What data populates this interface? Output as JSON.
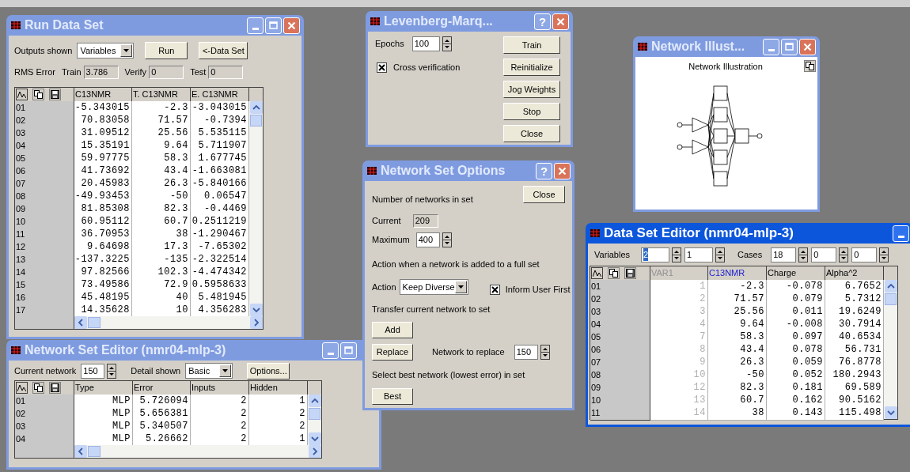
{
  "run_data_set": {
    "title": "Run Data Set",
    "active": false,
    "title_buttons": [
      {
        "kind": "minimize"
      },
      {
        "kind": "maximize"
      },
      {
        "kind": "close"
      }
    ],
    "outputs": {
      "label": "Outputs shown",
      "value": "Variables"
    },
    "buttons": [
      "Run",
      "<-Data Set"
    ],
    "rms": {
      "label": "RMS Error",
      "fields": [
        {
          "label": "Train",
          "value": "3.786"
        },
        {
          "label": "Verify",
          "value": "0"
        },
        {
          "label": "Test",
          "value": "0"
        }
      ]
    },
    "grid": {
      "columns": [
        {
          "label": "C13NMR"
        },
        {
          "label": "T. C13NMR"
        },
        {
          "label": "E. C13NMR"
        }
      ],
      "rows": [
        {
          "label": "01",
          "cells": [
            "-5.343015",
            "-2.3",
            "-3.043015"
          ]
        },
        {
          "label": "02",
          "cells": [
            "70.83058",
            "71.57",
            "-0.7394"
          ]
        },
        {
          "label": "03",
          "cells": [
            "31.09512",
            "25.56",
            "5.535115"
          ]
        },
        {
          "label": "04",
          "cells": [
            "15.35191",
            "9.64",
            "5.711907"
          ]
        },
        {
          "label": "05",
          "cells": [
            "59.97775",
            "58.3",
            "1.677745"
          ]
        },
        {
          "label": "06",
          "cells": [
            "41.73692",
            "43.4",
            "-1.663081"
          ]
        },
        {
          "label": "07",
          "cells": [
            "20.45983",
            "26.3",
            "-5.840166"
          ]
        },
        {
          "label": "08",
          "cells": [
            "-49.93453",
            "-50",
            "0.06547"
          ]
        },
        {
          "label": "09",
          "cells": [
            "81.85308",
            "82.3",
            "-0.4469"
          ]
        },
        {
          "label": "10",
          "cells": [
            "60.95112",
            "60.7",
            "0.2511219"
          ]
        },
        {
          "label": "11",
          "cells": [
            "36.70953",
            "38",
            "-1.290467"
          ]
        },
        {
          "label": "12",
          "cells": [
            "9.64698",
            "17.3",
            "-7.65302"
          ]
        },
        {
          "label": "13",
          "cells": [
            "-137.3225",
            "-135",
            "-2.322514"
          ]
        },
        {
          "label": "14",
          "cells": [
            "97.82566",
            "102.3",
            "-4.474342"
          ]
        },
        {
          "label": "15",
          "cells": [
            "73.49586",
            "72.9",
            "0.5958633"
          ]
        },
        {
          "label": "16",
          "cells": [
            "45.48195",
            "40",
            "5.481945"
          ]
        },
        {
          "label": "17",
          "cells": [
            "14.35628",
            "10",
            "4.356283"
          ]
        }
      ]
    }
  },
  "network_set_editor": {
    "title": "Network Set Editor (nmr04-mlp-3)",
    "active": false,
    "title_buttons": [
      {
        "kind": "minimize"
      },
      {
        "kind": "maximize"
      }
    ],
    "current": {
      "label": "Current network",
      "value": "150"
    },
    "detail": {
      "label": "Detail shown",
      "value": "Basic"
    },
    "options_button": "Options...",
    "grid": {
      "columns": [
        {
          "label": "Type"
        },
        {
          "label": "Error"
        },
        {
          "label": "Inputs"
        },
        {
          "label": "Hidden"
        }
      ],
      "rows": [
        {
          "label": "01",
          "cells": [
            "MLP",
            "5.726094",
            "2",
            "1"
          ]
        },
        {
          "label": "02",
          "cells": [
            "MLP",
            "5.656381",
            "2",
            "2"
          ]
        },
        {
          "label": "03",
          "cells": [
            "MLP",
            "5.340507",
            "2",
            "2"
          ]
        },
        {
          "label": "04",
          "cells": [
            "MLP",
            "5.26662",
            "2",
            "1"
          ]
        }
      ]
    }
  },
  "levenberg_marquardt": {
    "title": "Levenberg-Marq...",
    "active": false,
    "title_buttons": [
      {
        "kind": "help",
        "glyph": "?"
      },
      {
        "kind": "close"
      }
    ],
    "epochs": {
      "label": "Epochs",
      "value": "100"
    },
    "cross_verification": {
      "label": "Cross verification",
      "checked": true
    },
    "buttons": [
      "Train",
      "Reinitialize",
      "Jog Weights",
      "Stop",
      "Close"
    ]
  },
  "network_set_options": {
    "title": "Network Set Options",
    "active": false,
    "title_buttons": [
      {
        "kind": "help",
        "glyph": "?"
      },
      {
        "kind": "close"
      }
    ],
    "count_heading": "Number of networks in set",
    "close_button": "Close",
    "current": {
      "label": "Current",
      "value": "209"
    },
    "maximum": {
      "label": "Maximum",
      "value": "400"
    },
    "action_heading": "Action when a network is added to a full set",
    "action": {
      "label": "Action",
      "value": "Keep Diverse"
    },
    "inform_user": {
      "label": "Inform User First",
      "checked": true
    },
    "transfer_heading": "Transfer current network to set",
    "add_button": "Add",
    "replace_button": "Replace",
    "replace": {
      "label": "Network to replace",
      "value": "150"
    },
    "best_heading": "Select best network (lowest error) in set",
    "best_button": "Best"
  },
  "network_illustration": {
    "title": "Network Illust...",
    "active": false,
    "title_buttons": [
      {
        "kind": "minimize"
      },
      {
        "kind": "maximize"
      },
      {
        "kind": "close"
      }
    ],
    "heading": "Network Illustration"
  },
  "data_set_editor": {
    "title": "Data Set Editor (nmr04-mlp-3)",
    "active": true,
    "title_buttons": [
      {
        "kind": "minimize"
      }
    ],
    "variables": {
      "label": "Variables",
      "fields": [
        {
          "value": "2",
          "selected": true
        },
        {
          "value": "1",
          "selected": false
        }
      ]
    },
    "cases": {
      "label": "Cases",
      "fields": [
        {
          "value": "18",
          "selected": false
        },
        {
          "value": "0",
          "selected": false
        },
        {
          "value": "0",
          "selected": false
        }
      ]
    },
    "grid": {
      "columns": [
        {
          "label": "VAR1",
          "selected": false,
          "disabled": true
        },
        {
          "label": "C13NMR",
          "selected": true,
          "disabled": false
        },
        {
          "label": "Charge",
          "selected": false,
          "disabled": false
        },
        {
          "label": "Alpha^2",
          "selected": false,
          "disabled": false
        }
      ],
      "rows": [
        {
          "label": "01",
          "cells": [
            "1",
            "-2.3",
            "-0.078",
            "6.7652"
          ]
        },
        {
          "label": "02",
          "cells": [
            "2",
            "71.57",
            "0.079",
            "5.7312"
          ]
        },
        {
          "label": "03",
          "cells": [
            "3",
            "25.56",
            "0.011",
            "19.6249"
          ]
        },
        {
          "label": "04",
          "cells": [
            "4",
            "9.64",
            "-0.008",
            "30.7914"
          ]
        },
        {
          "label": "05",
          "cells": [
            "7",
            "58.3",
            "0.097",
            "40.6534"
          ]
        },
        {
          "label": "06",
          "cells": [
            "8",
            "43.4",
            "0.078",
            "56.731"
          ]
        },
        {
          "label": "07",
          "cells": [
            "9",
            "26.3",
            "0.059",
            "76.8778"
          ]
        },
        {
          "label": "08",
          "cells": [
            "10",
            "-50",
            "0.052",
            "180.2943"
          ]
        },
        {
          "label": "09",
          "cells": [
            "12",
            "82.3",
            "0.181",
            "69.589"
          ]
        },
        {
          "label": "10",
          "cells": [
            "13",
            "60.7",
            "0.162",
            "90.5162"
          ]
        },
        {
          "label": "11",
          "cells": [
            "14",
            "38",
            "0.143",
            "115.498"
          ]
        }
      ]
    }
  }
}
